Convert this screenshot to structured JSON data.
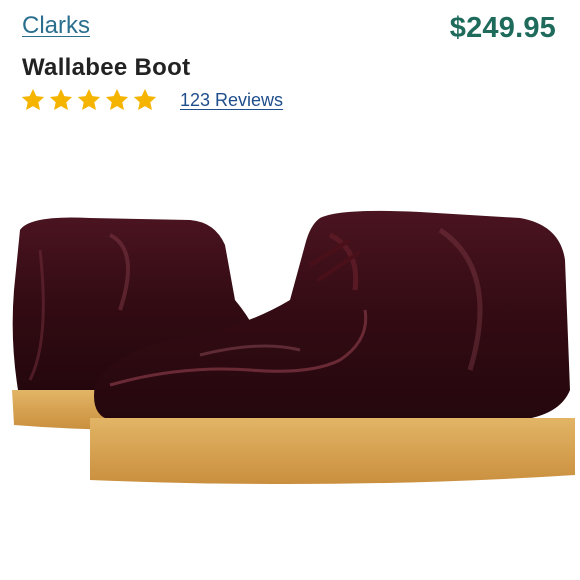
{
  "product": {
    "brand": "Clarks",
    "name": "Wallabee Boot",
    "price": "$249.95",
    "rating": {
      "value": 5,
      "max": 5
    },
    "reviews_label": "123 Reviews"
  },
  "colors": {
    "brand_link": "#2b6f8f",
    "price": "#1e6b5c",
    "star": "#f5b400",
    "reviews_link": "#1f4e8c",
    "leather": "#3a0d16",
    "crepe_sole": "#d9a550"
  },
  "icons": {
    "rating_star": "star-icon",
    "product_image": "boot-image"
  }
}
